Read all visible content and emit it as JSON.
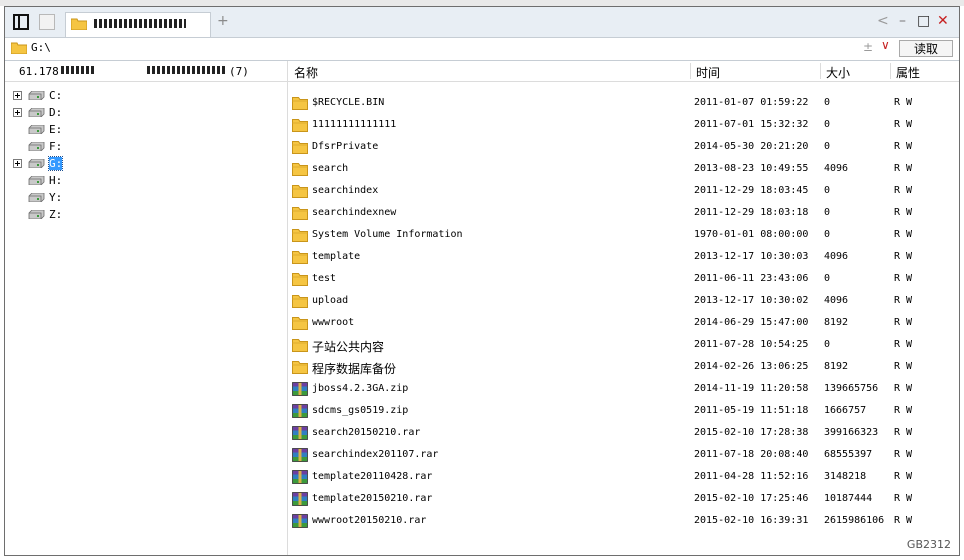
{
  "tabbar": {
    "tab_title": "",
    "add_label": "+",
    "back_glyph": "<",
    "min_glyph": "–",
    "max_glyph": "□",
    "close_glyph": "✕"
  },
  "address": {
    "path": "G:\\",
    "pm_glyph": "±",
    "dropdown_glyph": "∨",
    "read_button": "读取"
  },
  "left_panel": {
    "ip_prefix": "61.178",
    "count": "(7)",
    "drives": [
      {
        "label": "C:",
        "expandable": true,
        "selected": false
      },
      {
        "label": "D:",
        "expandable": true,
        "selected": false
      },
      {
        "label": "E:",
        "expandable": false,
        "selected": false
      },
      {
        "label": "F:",
        "expandable": false,
        "selected": false
      },
      {
        "label": "G:",
        "expandable": true,
        "selected": true
      },
      {
        "label": "H:",
        "expandable": false,
        "selected": false
      },
      {
        "label": "Y:",
        "expandable": false,
        "selected": false
      },
      {
        "label": "Z:",
        "expandable": false,
        "selected": false
      }
    ]
  },
  "columns": {
    "name": "名称",
    "time": "时间",
    "size": "大小",
    "attr": "属性"
  },
  "files": [
    {
      "name": "$RECYCLE.BIN",
      "time": "2011-01-07 01:59:22",
      "size": "0",
      "attr": "R W",
      "type": "folder"
    },
    {
      "name": "11111111111111",
      "time": "2011-07-01 15:32:32",
      "size": "0",
      "attr": "R W",
      "type": "folder"
    },
    {
      "name": "DfsrPrivate",
      "time": "2014-05-30 20:21:20",
      "size": "0",
      "attr": "R W",
      "type": "folder"
    },
    {
      "name": "search",
      "time": "2013-08-23 10:49:55",
      "size": "4096",
      "attr": "R W",
      "type": "folder"
    },
    {
      "name": "searchindex",
      "time": "2011-12-29 18:03:45",
      "size": "0",
      "attr": "R W",
      "type": "folder"
    },
    {
      "name": "searchindexnew",
      "time": "2011-12-29 18:03:18",
      "size": "0",
      "attr": "R W",
      "type": "folder"
    },
    {
      "name": "System Volume Information",
      "time": "1970-01-01 08:00:00",
      "size": "0",
      "attr": "R W",
      "type": "folder"
    },
    {
      "name": "template",
      "time": "2013-12-17 10:30:03",
      "size": "4096",
      "attr": "R W",
      "type": "folder"
    },
    {
      "name": "test",
      "time": "2011-06-11 23:43:06",
      "size": "0",
      "attr": "R W",
      "type": "folder"
    },
    {
      "name": "upload",
      "time": "2013-12-17 10:30:02",
      "size": "4096",
      "attr": "R W",
      "type": "folder"
    },
    {
      "name": "wwwroot",
      "time": "2014-06-29 15:47:00",
      "size": "8192",
      "attr": "R W",
      "type": "folder"
    },
    {
      "name": "子站公共内容",
      "time": "2011-07-28 10:54:25",
      "size": "0",
      "attr": "R W",
      "type": "folder"
    },
    {
      "name": "程序数据库备份",
      "time": "2014-02-26 13:06:25",
      "size": "8192",
      "attr": "R W",
      "type": "folder"
    },
    {
      "name": "jboss4.2.3GA.zip",
      "time": "2014-11-19 11:20:58",
      "size": "139665756",
      "attr": "R W",
      "type": "archive"
    },
    {
      "name": "sdcms_gs0519.zip",
      "time": "2011-05-19 11:51:18",
      "size": "1666757",
      "attr": "R W",
      "type": "archive"
    },
    {
      "name": "search20150210.rar",
      "time": "2015-02-10 17:28:38",
      "size": "399166323",
      "attr": "R W",
      "type": "archive"
    },
    {
      "name": "searchindex201107.rar",
      "time": "2011-07-18 20:08:40",
      "size": "68555397",
      "attr": "R W",
      "type": "archive"
    },
    {
      "name": "template20110428.rar",
      "time": "2011-04-28 11:52:16",
      "size": "3148218",
      "attr": "R W",
      "type": "archive"
    },
    {
      "name": "template20150210.rar",
      "time": "2015-02-10 17:25:46",
      "size": "10187444",
      "attr": "R W",
      "type": "archive"
    },
    {
      "name": "wwwroot20150210.rar",
      "time": "2015-02-10 16:39:31",
      "size": "2615986106",
      "attr": "R W",
      "type": "archive"
    }
  ],
  "status": {
    "encoding": "GB2312"
  },
  "colors": {
    "folder": "#f5c542",
    "folder_edge": "#c9951a",
    "selected": "#3399ff",
    "close": "#c62020"
  }
}
